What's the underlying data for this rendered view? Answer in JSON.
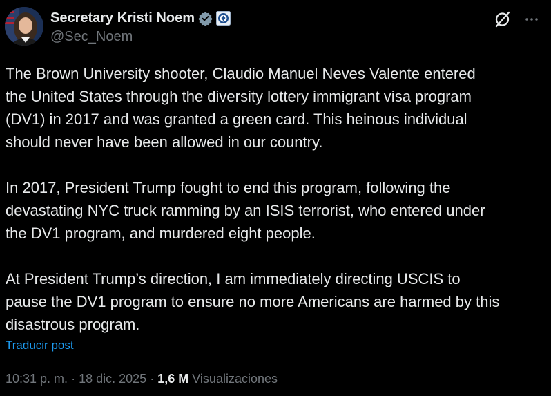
{
  "author": {
    "display_name": "Secretary Kristi Noem",
    "handle": "@Sec_Noem",
    "verified_badge": "verified-gray-check-icon",
    "affiliation_badge": "dhs-seal-icon",
    "badge_color": "#829aab"
  },
  "actions": {
    "grok_icon": "grok-icon",
    "more_icon": "more-horizontal-icon"
  },
  "post": {
    "paragraphs": [
      "The Brown University shooter, Claudio Manuel Neves Valente entered\nthe United States through the diversity lottery immigrant visa program\n(DV1) in 2017 and was granted a green card. This heinous individual\nshould never have been allowed in our country.",
      "In 2017, President Trump fought to end this program, following the\ndevastating NYC truck ramming by an ISIS terrorist, who entered under\nthe DV1 program, and murdered eight people.",
      "At President Trump’s direction, I am immediately directing USCIS to\npause the DV1 program to ensure no more Americans are harmed by this\ndisastrous program."
    ],
    "translate_label": "Traducir post"
  },
  "meta": {
    "time": "10:31 p. m.",
    "separator": "·",
    "date": "18 dic. 2025",
    "views_count": "1,6 M",
    "views_label": "Visualizaciones"
  },
  "colors": {
    "background": "#000000",
    "text": "#e7e9ea",
    "muted": "#71767b",
    "link": "#1d9bf0"
  }
}
